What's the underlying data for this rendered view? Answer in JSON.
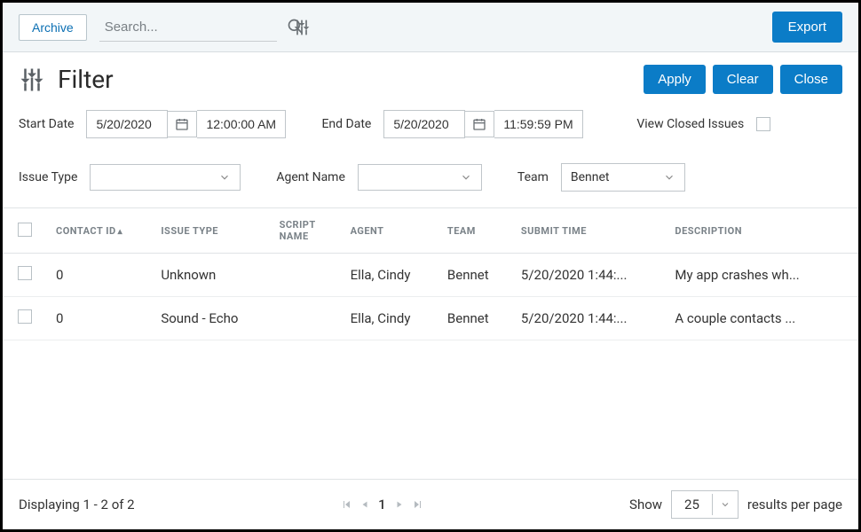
{
  "topbar": {
    "archive_label": "Archive",
    "search_placeholder": "Search...",
    "export_label": "Export"
  },
  "filter": {
    "title": "Filter",
    "apply_label": "Apply",
    "clear_label": "Clear",
    "close_label": "Close",
    "start_date_label": "Start Date",
    "start_date": "5/20/2020",
    "start_time": "12:00:00 AM",
    "end_date_label": "End Date",
    "end_date": "5/20/2020",
    "end_time": "11:59:59 PM",
    "view_closed_label": "View Closed Issues",
    "issue_type_label": "Issue Type",
    "issue_type_value": "",
    "agent_name_label": "Agent Name",
    "agent_name_value": "",
    "team_label": "Team",
    "team_value": "Bennet"
  },
  "table": {
    "columns": {
      "contact_id": "CONTACT ID",
      "issue_type": "ISSUE TYPE",
      "script_name": "SCRIPT NAME",
      "agent": "AGENT",
      "team": "TEAM",
      "submit_time": "SUBMIT TIME",
      "description": "DESCRIPTION"
    },
    "rows": [
      {
        "contact_id": "0",
        "issue_type": "Unknown",
        "script_name": "",
        "agent": "Ella, Cindy",
        "team": "Bennet",
        "submit_time": "5/20/2020 1:44:...",
        "description": "My app crashes wh..."
      },
      {
        "contact_id": "0",
        "issue_type": "Sound - Echo",
        "script_name": "",
        "agent": "Ella, Cindy",
        "team": "Bennet",
        "submit_time": "5/20/2020 1:44:...",
        "description": "A couple contacts ..."
      }
    ]
  },
  "footer": {
    "displaying": "Displaying 1 - 2 of 2",
    "current_page": "1",
    "show_label": "Show",
    "page_size": "25",
    "results_label": "results per page"
  }
}
